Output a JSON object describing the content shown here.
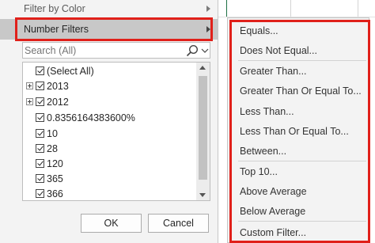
{
  "menu": {
    "filter_by_color": "Filter by Color",
    "number_filters": "Number Filters"
  },
  "search": {
    "placeholder": "Search (All)"
  },
  "list": {
    "select_all": "(Select All)",
    "items": [
      "2013",
      "2012",
      "0.8356164383600%",
      "10",
      "28",
      "120",
      "365",
      "366"
    ]
  },
  "buttons": {
    "ok": "OK",
    "cancel": "Cancel"
  },
  "submenu": {
    "equals": "Equals...",
    "does_not_equal": "Does Not Equal...",
    "greater_than": "Greater Than...",
    "greater_than_or_equal": "Greater Than Or Equal To...",
    "less_than": "Less Than...",
    "less_than_or_equal": "Less Than Or Equal To...",
    "between": "Between...",
    "top_10": "Top 10...",
    "above_average": "Above Average",
    "below_average": "Below Average",
    "custom_filter": "Custom Filter..."
  },
  "colors": {
    "highlight": "#e0201a",
    "accent_green": "#1d7044"
  }
}
